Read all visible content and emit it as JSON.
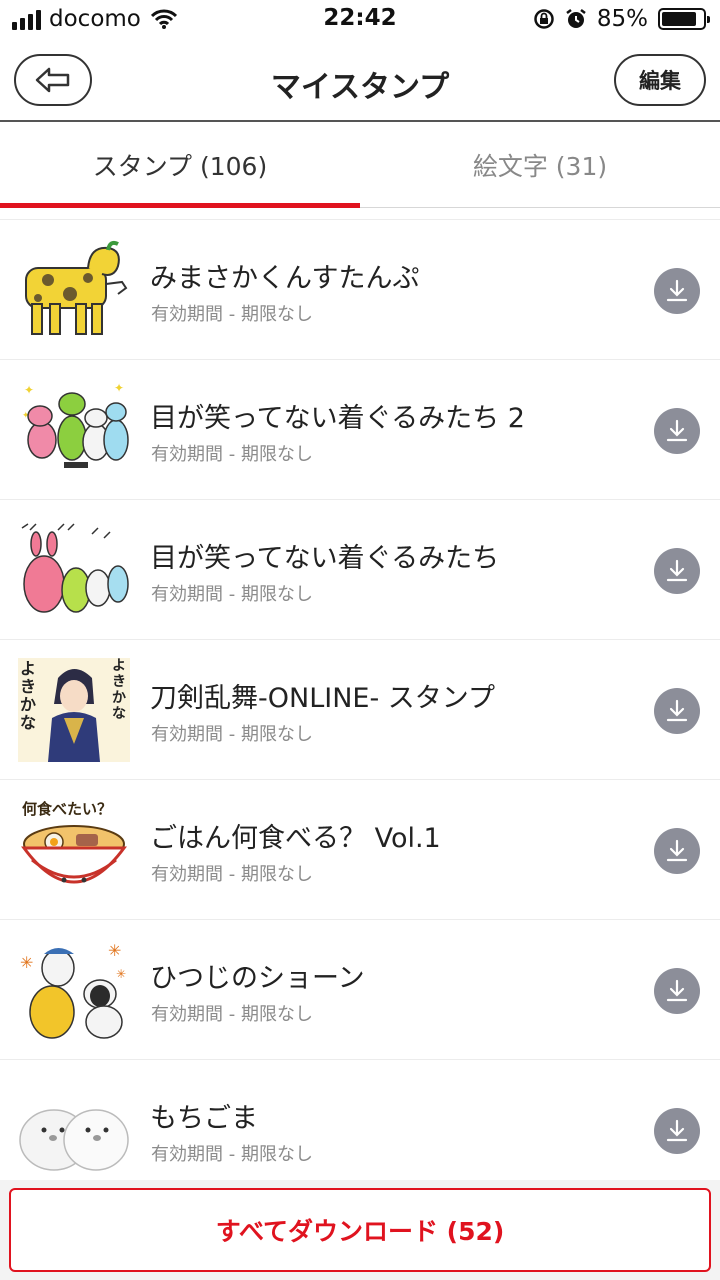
{
  "status_bar": {
    "carrier": "docomo",
    "time": "22:42",
    "battery_percent": "85%",
    "battery_level": 0.85,
    "icons": [
      "signal-icon",
      "wifi-icon",
      "rotation-lock-icon",
      "alarm-icon",
      "battery-icon"
    ]
  },
  "nav": {
    "title": "マイスタンプ",
    "back_icon": "back-arrow-icon",
    "edit_label": "編集"
  },
  "tabs": [
    {
      "label": "スタンプ (106)",
      "active": true
    },
    {
      "label": "絵文字 (31)",
      "active": false
    }
  ],
  "stickers": [
    {
      "title": "みまさかくんすたんぷ",
      "subtitle": "有効期間 - 期限なし"
    },
    {
      "title": "目が笑ってない着ぐるみたち 2",
      "subtitle": "有効期間 - 期限なし"
    },
    {
      "title": "目が笑ってない着ぐるみたち",
      "subtitle": "有効期間 - 期限なし"
    },
    {
      "title": "刀剣乱舞-ONLINE- スタンプ",
      "subtitle": "有効期間 - 期限なし",
      "thumb_text_left": "よきかな",
      "thumb_text_right": "よきかな"
    },
    {
      "title": "ごはん何食べる？ Vol.1",
      "subtitle": "有効期間 - 期限なし",
      "thumb_text": "何食べたい？"
    },
    {
      "title": "ひつじのショーン",
      "subtitle": "有効期間 - 期限なし"
    },
    {
      "title": "もちごま",
      "subtitle": "有効期間 - 期限なし"
    }
  ],
  "download_all_label": "すべてダウンロード (52)",
  "colors": {
    "accent": "#e0131f",
    "download_button": "#8c8e99"
  }
}
